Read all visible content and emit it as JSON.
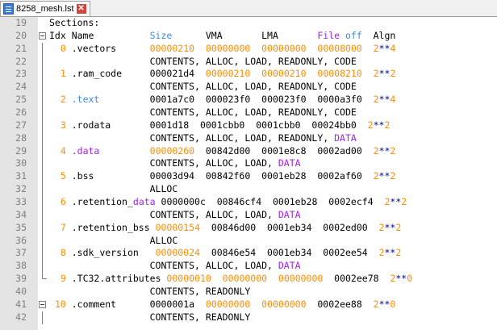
{
  "tab": {
    "filename": "8258_mesh.lst",
    "close_glyph": "✕"
  },
  "colors": {
    "keyword_blue": "#3c8ae6",
    "keyword_purple": "#a020f0",
    "number_orange": "#ff8c00",
    "navy": "#00008b"
  },
  "lines": [
    {
      "n": "19",
      "fold": "none",
      "segs": [
        {
          "t": "Sections:"
        }
      ]
    },
    {
      "n": "20",
      "fold": "box",
      "segs": [
        {
          "t": "Idx Name          "
        },
        {
          "t": "Size",
          "c": "kw"
        },
        {
          "t": "      VMA       LMA       "
        },
        {
          "t": "File",
          "c": "pr"
        },
        {
          "t": " "
        },
        {
          "t": "off",
          "c": "kw"
        },
        {
          "t": "  Algn"
        }
      ]
    },
    {
      "n": "21",
      "fold": "line",
      "segs": [
        {
          "t": "  "
        },
        {
          "t": "0",
          "c": "or"
        },
        {
          "t": " .vectors      "
        },
        {
          "t": "00000210",
          "c": "or"
        },
        {
          "t": "  "
        },
        {
          "t": "00000000",
          "c": "or"
        },
        {
          "t": "  "
        },
        {
          "t": "00000000",
          "c": "or"
        },
        {
          "t": "  "
        },
        {
          "t": "00008000",
          "c": "or"
        },
        {
          "t": "  "
        },
        {
          "t": "2",
          "c": "or"
        },
        {
          "t": "**",
          "c": "nv"
        },
        {
          "t": "4",
          "c": "or"
        }
      ]
    },
    {
      "n": "22",
      "fold": "line",
      "gutter": true,
      "segs": [
        {
          "t": "                  CONTENTS, ALLOC, LOAD, READONLY, CODE"
        }
      ]
    },
    {
      "n": "23",
      "fold": "line",
      "segs": [
        {
          "t": "  "
        },
        {
          "t": "1",
          "c": "or"
        },
        {
          "t": " .ram_code     000021d4  "
        },
        {
          "t": "00000210",
          "c": "or"
        },
        {
          "t": "  "
        },
        {
          "t": "00000210",
          "c": "or"
        },
        {
          "t": "  "
        },
        {
          "t": "00008210",
          "c": "or"
        },
        {
          "t": "  "
        },
        {
          "t": "2",
          "c": "or"
        },
        {
          "t": "**",
          "c": "nv"
        },
        {
          "t": "2",
          "c": "or"
        }
      ]
    },
    {
      "n": "24",
      "fold": "line",
      "gutter": true,
      "segs": [
        {
          "t": "                  CONTENTS, ALLOC, LOAD, READONLY, CODE"
        }
      ]
    },
    {
      "n": "25",
      "fold": "line",
      "segs": [
        {
          "t": "  "
        },
        {
          "t": "2",
          "c": "or"
        },
        {
          "t": " "
        },
        {
          "t": ".text",
          "c": "kw"
        },
        {
          "t": "         0001a7c0  000023f0  000023f0  0000a3f0  "
        },
        {
          "t": "2",
          "c": "or"
        },
        {
          "t": "**",
          "c": "nv"
        },
        {
          "t": "4",
          "c": "or"
        }
      ]
    },
    {
      "n": "26",
      "fold": "line",
      "gutter": true,
      "segs": [
        {
          "t": "                  CONTENTS, ALLOC, LOAD, READONLY, CODE"
        }
      ]
    },
    {
      "n": "27",
      "fold": "line",
      "segs": [
        {
          "t": "  "
        },
        {
          "t": "3",
          "c": "or"
        },
        {
          "t": " .rodata       0001d18  0001cbb0  0001cbb0  00024bb0  "
        },
        {
          "t": "2",
          "c": "or"
        },
        {
          "t": "**",
          "c": "nv"
        },
        {
          "t": "2",
          "c": "or"
        }
      ]
    },
    {
      "n": "28",
      "fold": "line",
      "gutter": true,
      "segs": [
        {
          "t": "                  CONTENTS, ALLOC, LOAD, READONLY, "
        },
        {
          "t": "DATA",
          "c": "pr"
        }
      ]
    },
    {
      "n": "29",
      "fold": "line",
      "segs": [
        {
          "t": "  "
        },
        {
          "t": "4",
          "c": "or"
        },
        {
          "t": " "
        },
        {
          "t": ".data",
          "c": "pr"
        },
        {
          "t": "         "
        },
        {
          "t": "00000260",
          "c": "or"
        },
        {
          "t": "  00842d00  0001e8c8  0002ad00  "
        },
        {
          "t": "2",
          "c": "or"
        },
        {
          "t": "**",
          "c": "nv"
        },
        {
          "t": "2",
          "c": "or"
        }
      ]
    },
    {
      "n": "30",
      "fold": "line",
      "gutter": true,
      "segs": [
        {
          "t": "                  CONTENTS, ALLOC, LOAD, "
        },
        {
          "t": "DATA",
          "c": "pr"
        }
      ]
    },
    {
      "n": "31",
      "fold": "line",
      "segs": [
        {
          "t": "  "
        },
        {
          "t": "5",
          "c": "or"
        },
        {
          "t": " .bss          00003d94  00842f60  0001eb28  0002af60  "
        },
        {
          "t": "2",
          "c": "or"
        },
        {
          "t": "**",
          "c": "nv"
        },
        {
          "t": "2",
          "c": "or"
        }
      ]
    },
    {
      "n": "32",
      "fold": "line",
      "gutter": true,
      "segs": [
        {
          "t": "                  ALLOC"
        }
      ]
    },
    {
      "n": "33",
      "fold": "line",
      "segs": [
        {
          "t": "  "
        },
        {
          "t": "6",
          "c": "or"
        },
        {
          "t": " .retention_"
        },
        {
          "t": "data",
          "c": "pr"
        },
        {
          "t": " 0000000c  00846cf4  0001eb28  0002ecf4  "
        },
        {
          "t": "2",
          "c": "or"
        },
        {
          "t": "**",
          "c": "nv"
        },
        {
          "t": "2",
          "c": "or"
        }
      ]
    },
    {
      "n": "34",
      "fold": "line",
      "gutter": true,
      "segs": [
        {
          "t": "                  CONTENTS, ALLOC, LOAD, "
        },
        {
          "t": "DATA",
          "c": "pr"
        }
      ]
    },
    {
      "n": "35",
      "fold": "line",
      "segs": [
        {
          "t": "  "
        },
        {
          "t": "7",
          "c": "or"
        },
        {
          "t": " .retention_bss "
        },
        {
          "t": "00000154",
          "c": "or"
        },
        {
          "t": "  00846d00  0001eb34  0002ed00  "
        },
        {
          "t": "2",
          "c": "or"
        },
        {
          "t": "**",
          "c": "nv"
        },
        {
          "t": "2",
          "c": "or"
        }
      ]
    },
    {
      "n": "36",
      "fold": "line",
      "gutter": true,
      "segs": [
        {
          "t": "                  ALLOC"
        }
      ]
    },
    {
      "n": "37",
      "fold": "line",
      "segs": [
        {
          "t": "  "
        },
        {
          "t": "8",
          "c": "or"
        },
        {
          "t": " .sdk_version   "
        },
        {
          "t": "00000024",
          "c": "or"
        },
        {
          "t": "  00846e54  0001eb34  0002ee54  "
        },
        {
          "t": "2",
          "c": "or"
        },
        {
          "t": "**",
          "c": "nv"
        },
        {
          "t": "2",
          "c": "or"
        }
      ]
    },
    {
      "n": "38",
      "fold": "line",
      "gutter": true,
      "segs": [
        {
          "t": "                  CONTENTS, ALLOC, LOAD, "
        },
        {
          "t": "DATA",
          "c": "pr"
        }
      ]
    },
    {
      "n": "39",
      "fold": "end",
      "segs": [
        {
          "t": "  "
        },
        {
          "t": "9",
          "c": "or"
        },
        {
          "t": " .TC32.attributes "
        },
        {
          "t": "00000010",
          "c": "or"
        },
        {
          "t": "  "
        },
        {
          "t": "00000000",
          "c": "or"
        },
        {
          "t": "  "
        },
        {
          "t": "00000000",
          "c": "or"
        },
        {
          "t": "  0002ee78  "
        },
        {
          "t": "2",
          "c": "or"
        },
        {
          "t": "**",
          "c": "nv"
        },
        {
          "t": "0",
          "c": "or"
        }
      ]
    },
    {
      "n": "40",
      "fold": "none",
      "gutter": true,
      "segs": [
        {
          "t": "                  CONTENTS, READONLY"
        }
      ]
    },
    {
      "n": "41",
      "fold": "box",
      "segs": [
        {
          "t": " "
        },
        {
          "t": "10",
          "c": "or"
        },
        {
          "t": " .comment      0000001a  "
        },
        {
          "t": "00000000",
          "c": "or"
        },
        {
          "t": "  "
        },
        {
          "t": "00000000",
          "c": "or"
        },
        {
          "t": "  0002ee88  "
        },
        {
          "t": "2",
          "c": "or"
        },
        {
          "t": "**",
          "c": "nv"
        },
        {
          "t": "0",
          "c": "or"
        }
      ]
    },
    {
      "n": "42",
      "fold": "line",
      "gutter": true,
      "segs": [
        {
          "t": "                  CONTENTS, READONLY"
        }
      ]
    }
  ]
}
